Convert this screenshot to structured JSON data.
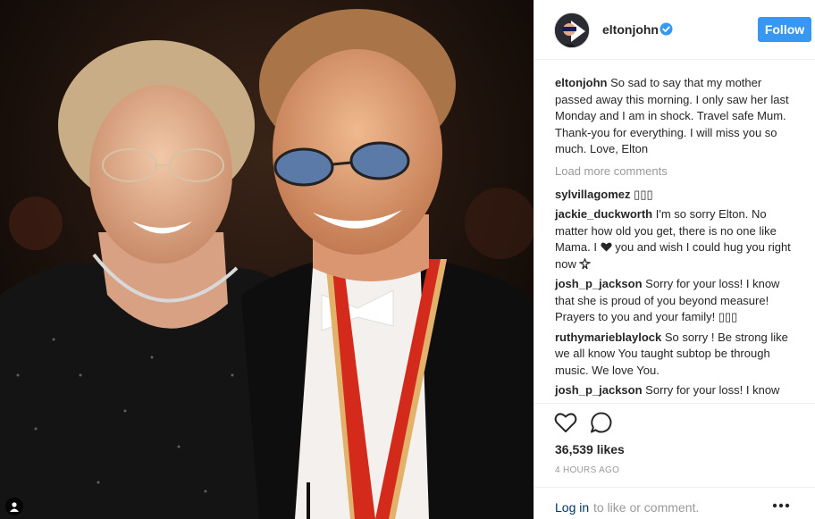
{
  "post": {
    "photo_alt": "elton john and mother",
    "username": "eltonjohn",
    "follow_label": "Follow",
    "caption_user": "eltonjohn",
    "caption_text": "So sad to say that my mother passed away this morning. I only saw her last Monday and I am in shock. Travel safe Mum. Thank-you for everything. I will miss you so much. Love, Elton",
    "load_more": "Load more comments",
    "comments": [
      {
        "user": "sylvillagomez",
        "text": "▯▯▯"
      },
      {
        "user": "jackie_duckworth",
        "text_before": "I'm so sorry Elton. No matter how old you get, there is no one like Mama. I",
        "text_after": "you and wish I could hug you right now"
      },
      {
        "user": "josh_p_jackson",
        "text": "Sorry for your loss! I know that she is proud of you beyond measure! Prayers to you and your family! ▯▯▯"
      },
      {
        "user": "ruthymarieblaylock",
        "text": "So sorry ! Be strong like we all know You taught subtop be through music. We love You."
      },
      {
        "user": "josh_p_jackson",
        "text": "Sorry for your loss! I know"
      }
    ],
    "likes": "36,539 likes",
    "timestamp": "4 HOURS AGO",
    "login_link": "Log in",
    "login_text": "to like or comment."
  },
  "icons": {
    "verified": "verified-badge-icon",
    "like": "heart-outline-icon",
    "comment": "speech-bubble-icon",
    "more": "ellipsis-icon",
    "user_tag": "user-tag-icon"
  },
  "colors": {
    "follow_button": "#3897f0",
    "verified": "#3897f0",
    "link": "#003569",
    "muted": "#999999"
  }
}
